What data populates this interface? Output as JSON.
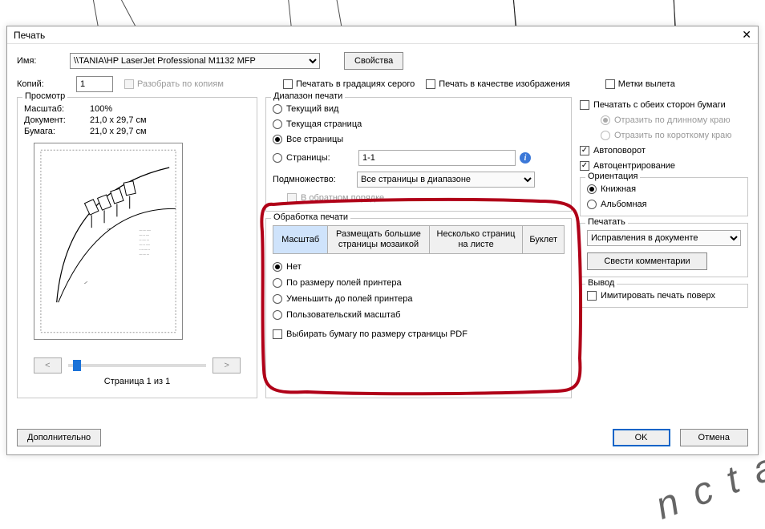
{
  "dialog": {
    "title": "Печать",
    "name_label": "Имя:",
    "printer": "\\\\TANIA\\HP LaserJet Professional M1132 MFP",
    "properties_btn": "Свойства",
    "copies_label": "Копий:",
    "copies_value": "1",
    "collate": "Разобрать по копиям",
    "grayscale": "Печатать в градациях серого",
    "as_image": "Печать в качестве изображения",
    "bleed_marks": "Метки вылета"
  },
  "preview": {
    "title": "Просмотр",
    "scale_k": "Масштаб:",
    "scale_v": "100%",
    "doc_k": "Документ:",
    "doc_v": "21,0 x 29,7 см",
    "paper_k": "Бумага:",
    "paper_v": "21,0 x 29,7 см",
    "page_label": "Страница 1 из 1"
  },
  "range": {
    "title": "Диапазон печати",
    "current_view": "Текущий вид",
    "current_page": "Текущая страница",
    "all_pages": "Все страницы",
    "pages": "Страницы:",
    "pages_value": "1-1",
    "subset_label": "Подмножество:",
    "subset_value": "Все страницы в диапазоне",
    "reverse": "В обратном порядке"
  },
  "handling": {
    "title": "Обработка печати",
    "tab_scale": "Масштаб",
    "tab_poster": "Размещать большие страницы мозаикой",
    "tab_multi": "Несколько страниц на листе",
    "tab_booklet": "Буклет",
    "opt_none": "Нет",
    "opt_fit": "По размеру полей принтера",
    "opt_shrink": "Уменьшить до полей принтера",
    "opt_custom": "Пользовательский масштаб",
    "choose_paper": "Выбирать бумагу по размеру страницы PDF"
  },
  "right": {
    "duplex": "Печатать с обеих сторон бумаги",
    "flip_long": "Отразить по длинному краю",
    "flip_short": "Отразить по короткому краю",
    "autorotate": "Автоповорот",
    "autocenter": "Автоцентрирование",
    "orient_title": "Ориентация",
    "orient_portrait": "Книжная",
    "orient_landscape": "Альбомная",
    "print_title": "Печатать",
    "print_what": "Исправления в документе",
    "summarize": "Свести комментарии",
    "output_title": "Вывод",
    "simulate": "Имитировать печать поверх"
  },
  "footer": {
    "advanced": "Дополнительно",
    "ok": "OK",
    "cancel": "Отмена"
  }
}
